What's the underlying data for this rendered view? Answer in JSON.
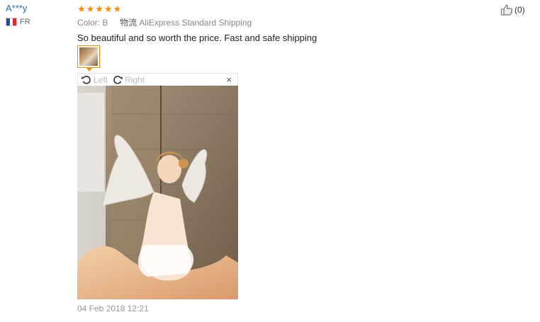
{
  "reviewer": {
    "name": "A***y",
    "country": "FR"
  },
  "review": {
    "rating": 5,
    "color_label": "Color:",
    "color_value": "B",
    "shipping_prefix": "物流",
    "shipping_method": "AliExpress Standard Shipping",
    "text": "So beautiful and so worth the price. Fast and safe shipping",
    "date": "04 Feb 2018 12:21"
  },
  "viewer": {
    "rotate_left": "Left",
    "rotate_right": "Right",
    "close": "×"
  },
  "helpful": {
    "count": "(0)"
  },
  "colors": {
    "accent": "#ff8a00",
    "link": "#2b6bb5"
  }
}
